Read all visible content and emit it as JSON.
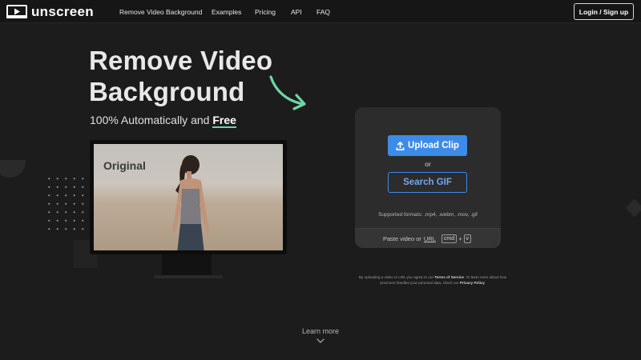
{
  "header": {
    "logo_text": "unscreen",
    "nav": [
      "Remove Video Background",
      "Examples",
      "Pricing",
      "API",
      "FAQ"
    ],
    "login_label": "Login / Sign up"
  },
  "hero": {
    "title_line1": "Remove Video",
    "title_line2": "Background",
    "subtitle_prefix": "100% Automatically and ",
    "subtitle_highlight": "Free"
  },
  "preview": {
    "label": "Original"
  },
  "upload": {
    "upload_label": "Upload Clip",
    "or_text": "or",
    "search_label": "Search GIF",
    "formats_text": "Supported formats: .mp4, .webm, .mov, .gif",
    "paste_prefix": "Paste video or",
    "paste_url": "URL",
    "key_cmd": "cmd",
    "key_plus": "+",
    "key_v": "v"
  },
  "legal": {
    "text_1": "By uploading a video or URL you agree to our ",
    "terms": "Terms of Service",
    "text_2": ". To learn more about how Unscreen handles your personal data, check our ",
    "privacy": "Privacy Policy",
    "text_3": "."
  },
  "footer": {
    "learn_more": "Learn more"
  },
  "colors": {
    "background": "#1c1c1c",
    "accent_blue": "#3d8be8",
    "accent_green": "#6fd3a6"
  }
}
